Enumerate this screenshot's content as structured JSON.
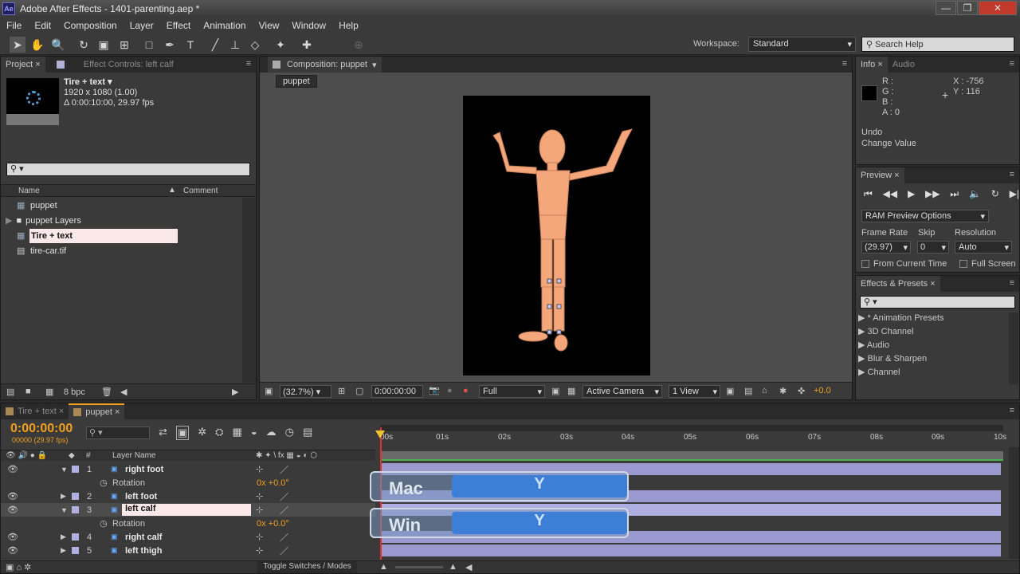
{
  "window": {
    "app_badge": "Ae",
    "title": "Adobe After Effects - 1401-parenting.aep *",
    "min": "—",
    "max": "❐",
    "close": "✕"
  },
  "menu": [
    "File",
    "Edit",
    "Composition",
    "Layer",
    "Effect",
    "Animation",
    "View",
    "Window",
    "Help"
  ],
  "toolbar": {
    "workspace_label": "Workspace:",
    "workspace_value": "Standard",
    "search_placeholder": "Search Help"
  },
  "project": {
    "tab_project": "Project",
    "tab_effect": "Effect Controls: left calf",
    "item_name": "Tire + text ▾",
    "item_size": "1920 x 1080 (1.00)",
    "item_duration": "Δ 0:00:10:00, 29.97 fps",
    "col_name": "Name",
    "col_comment": "Comment",
    "items": [
      {
        "name": "puppet",
        "kind": "comp"
      },
      {
        "name": "puppet Layers",
        "kind": "folder"
      },
      {
        "name": "Tire + text",
        "kind": "comp"
      },
      {
        "name": "tire-car.tif",
        "kind": "file"
      }
    ],
    "bpc": "8 bpc"
  },
  "composition": {
    "tab": "Composition: puppet",
    "breadcrumb": "puppet",
    "zoom": "(32.7%)",
    "timecode": "0:00:00:00",
    "resolution": "Full",
    "camera": "Active Camera",
    "views": "1 View",
    "exposure": "+0.0"
  },
  "info": {
    "tab_info": "Info",
    "tab_audio": "Audio",
    "r": "R :",
    "g": "G :",
    "b": "B :",
    "a": "A : 0",
    "x": "X : -756",
    "y": "Y : 116",
    "undo": "Undo",
    "undo_detail": "Change Value"
  },
  "preview": {
    "tab": "Preview",
    "options": "RAM Preview Options",
    "frame_rate_label": "Frame Rate",
    "skip_label": "Skip",
    "resolution_label": "Resolution",
    "frame_rate": "(29.97)",
    "skip": "0",
    "resolution": "Auto",
    "from_current": "From Current Time",
    "full_screen": "Full Screen"
  },
  "effects": {
    "tab": "Effects & Presets",
    "items": [
      "* Animation Presets",
      "3D Channel",
      "Audio",
      "Blur & Sharpen",
      "Channel"
    ]
  },
  "timeline": {
    "tab1": "Tire + text",
    "tab2": "puppet",
    "timecode": "0:00:00:00",
    "fps": "00000 (29.97 fps)",
    "col_layer": "Layer Name",
    "col_num": "#",
    "ruler": [
      "00s",
      "01s",
      "02s",
      "03s",
      "04s",
      "05s",
      "06s",
      "07s",
      "08s",
      "09s",
      "10s"
    ],
    "layers": [
      {
        "num": "1",
        "name": "right foot",
        "expanded": true
      },
      {
        "prop": "Rotation",
        "value": "0x +0.0°"
      },
      {
        "num": "2",
        "name": "left foot",
        "expanded": false
      },
      {
        "num": "3",
        "name": "left calf",
        "expanded": true,
        "selected": true
      },
      {
        "prop": "Rotation",
        "value": "0x +0.0°"
      },
      {
        "num": "4",
        "name": "right calf",
        "expanded": false
      },
      {
        "num": "5",
        "name": "left thigh",
        "expanded": false
      }
    ],
    "toggle": "Toggle Switches / Modes"
  },
  "overlay": {
    "mac": "Mac",
    "win": "Win",
    "key": "Y"
  },
  "colors": {
    "accent": "#f0a020",
    "layer_bar": "#9a9ad0",
    "key_blue": "#3d7fd6"
  }
}
